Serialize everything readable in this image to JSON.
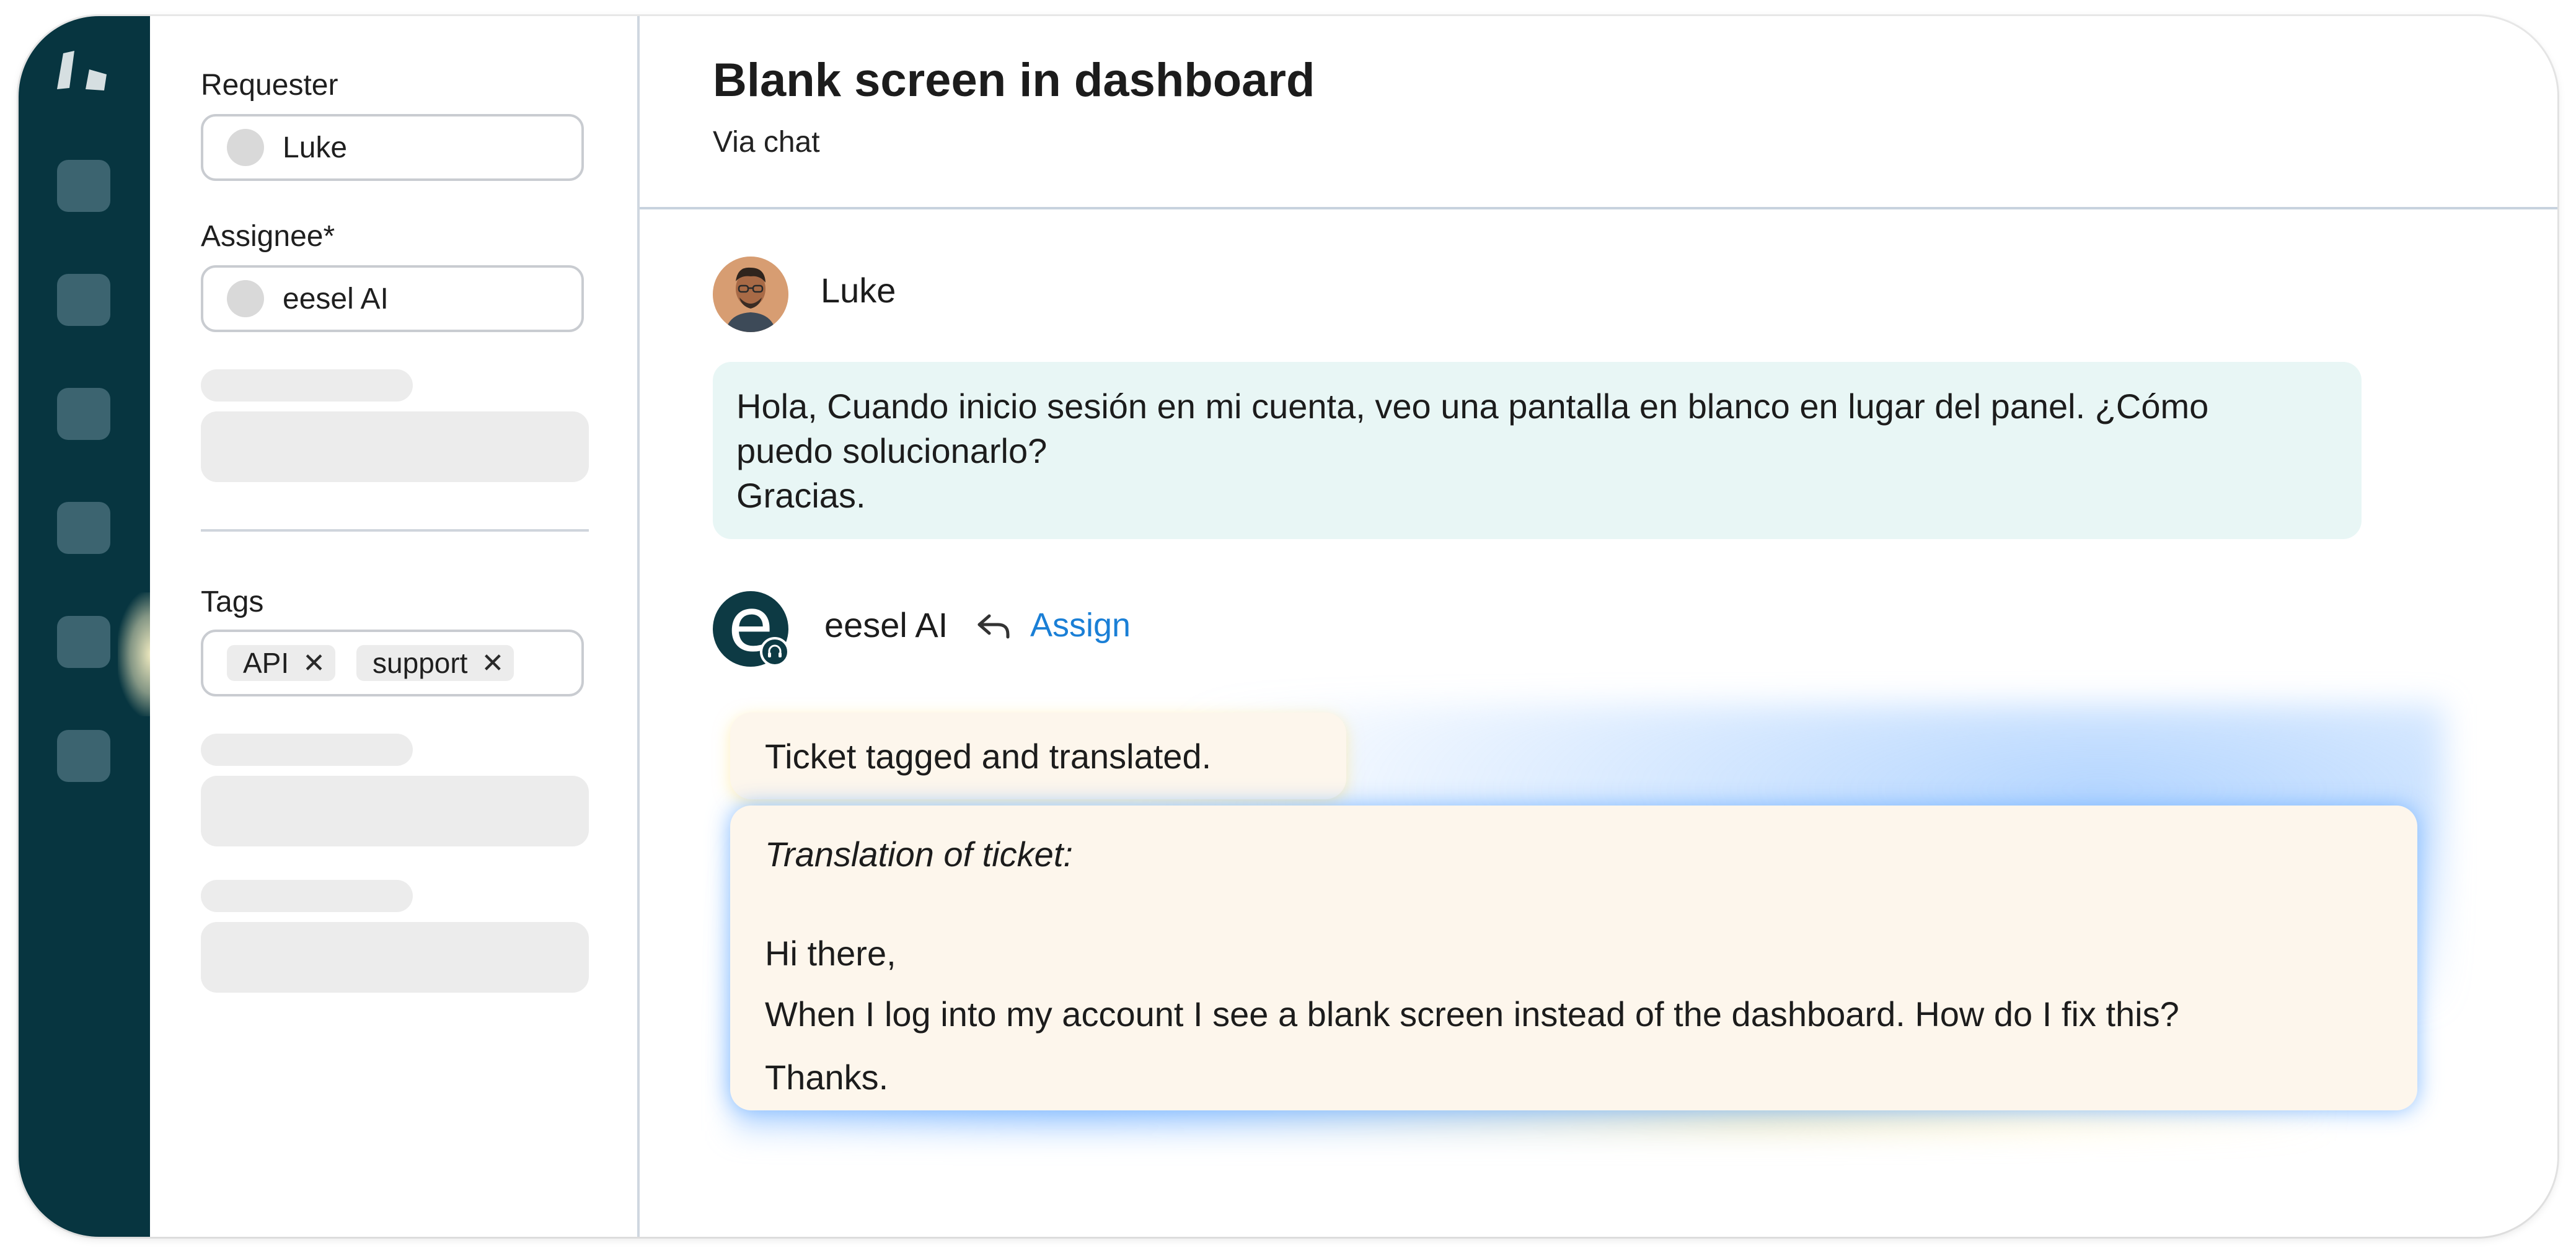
{
  "sidebar": {
    "items": [
      "nav-item-1",
      "nav-item-2",
      "nav-item-3",
      "nav-item-4",
      "nav-item-5",
      "nav-item-6"
    ]
  },
  "panel": {
    "requester": {
      "label": "Requester",
      "value": "Luke"
    },
    "assignee": {
      "label": "Assignee*",
      "value": "eesel AI"
    },
    "tags": {
      "label": "Tags",
      "items": [
        "API",
        "support"
      ]
    },
    "tag_remove_glyph": "✕"
  },
  "ticket": {
    "title": "Blank screen in dashboard",
    "channel": "Via chat"
  },
  "messages": {
    "customer": {
      "author": "Luke",
      "lines": [
        "Hola, Cuando inicio sesión en mi cuenta, veo una pantalla en blanco en lugar del panel. ¿Cómo",
        "puedo solucionarlo?",
        "Gracias."
      ]
    },
    "agent": {
      "author": "eesel AI",
      "avatar_letter": "e",
      "action_label": "Assign",
      "status": "Ticket tagged and translated.",
      "translation_title": "Translation of ticket:",
      "translation_lines": [
        "Hi there,",
        "When I log into my account I see a blank screen instead of the dashboard. How do I fix this?",
        "Thanks."
      ]
    }
  },
  "colors": {
    "rail": "#073540",
    "link": "#1a7fd6",
    "customer_bubble": "#e8f6f5",
    "ai_card": "#fdf6ec"
  }
}
